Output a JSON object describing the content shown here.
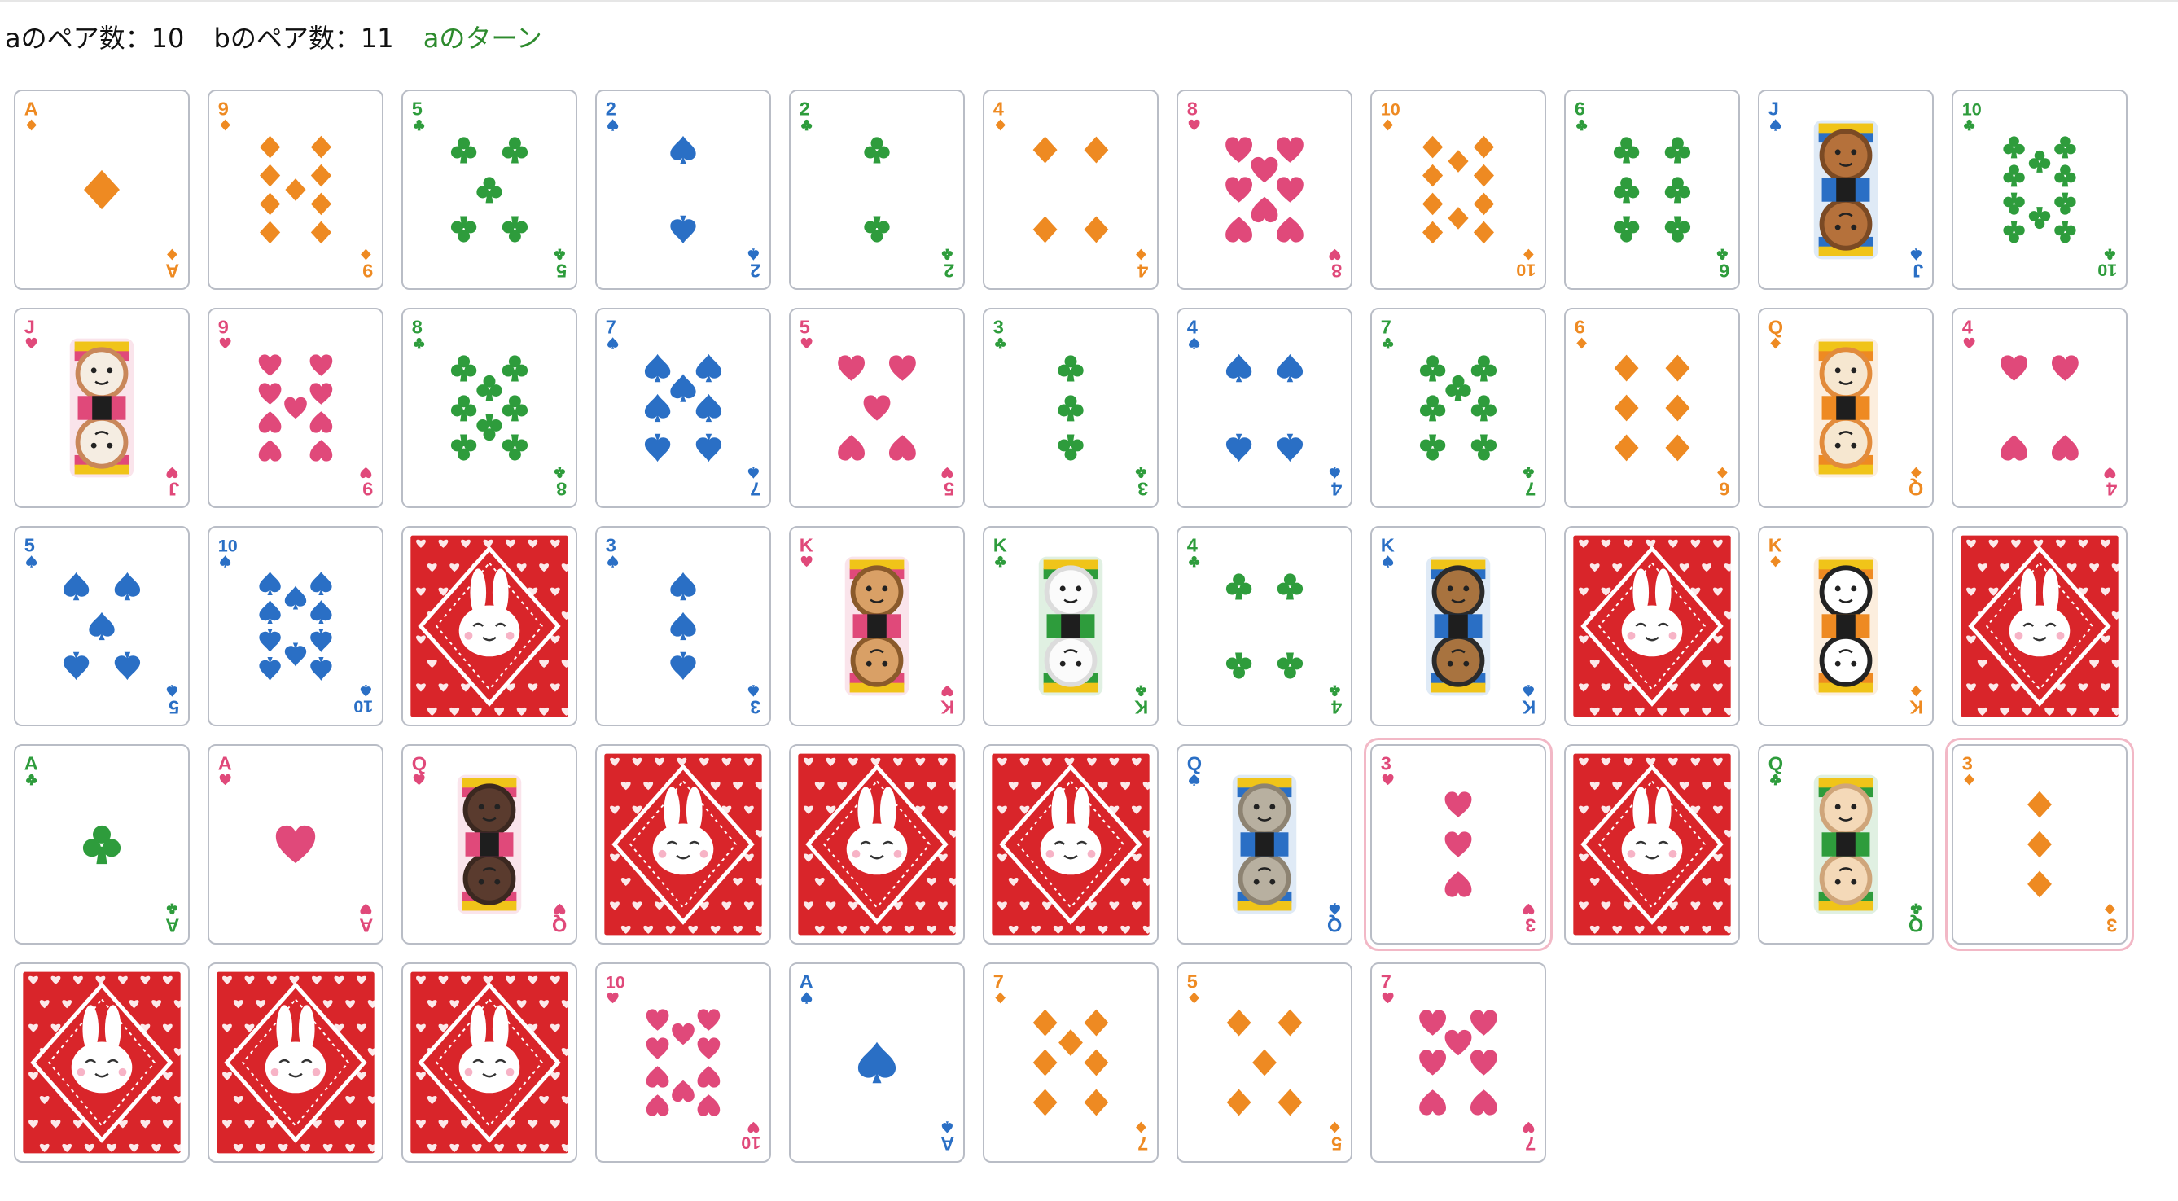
{
  "status": {
    "a_pairs": "aのペア数：10",
    "b_pairs": "bのペア数：11",
    "turn": "aのターン"
  },
  "suit_colors": {
    "D": "#ee8a22",
    "H": "#e0497a",
    "C": "#2e9c3c",
    "S": "#2a6fc5"
  },
  "back_colors": {
    "base": "#d9252a",
    "pattern": "#ffffff"
  },
  "rows": [
    [
      {
        "face": "up",
        "rank": "A",
        "suit": "D"
      },
      {
        "face": "up",
        "rank": "9",
        "suit": "D"
      },
      {
        "face": "up",
        "rank": "5",
        "suit": "C"
      },
      {
        "face": "up",
        "rank": "2",
        "suit": "S"
      },
      {
        "face": "up",
        "rank": "2",
        "suit": "C"
      },
      {
        "face": "up",
        "rank": "4",
        "suit": "D"
      },
      {
        "face": "up",
        "rank": "8",
        "suit": "H"
      },
      {
        "face": "up",
        "rank": "10",
        "suit": "D"
      },
      {
        "face": "up",
        "rank": "6",
        "suit": "C"
      },
      {
        "face": "up",
        "rank": "J",
        "suit": "S",
        "character": "dog-jack"
      },
      {
        "face": "up",
        "rank": "10",
        "suit": "C"
      }
    ],
    [
      {
        "face": "up",
        "rank": "J",
        "suit": "H",
        "character": "bulldog-jack"
      },
      {
        "face": "up",
        "rank": "9",
        "suit": "H"
      },
      {
        "face": "up",
        "rank": "8",
        "suit": "C"
      },
      {
        "face": "up",
        "rank": "7",
        "suit": "S"
      },
      {
        "face": "up",
        "rank": "5",
        "suit": "H"
      },
      {
        "face": "up",
        "rank": "3",
        "suit": "C"
      },
      {
        "face": "up",
        "rank": "4",
        "suit": "S"
      },
      {
        "face": "up",
        "rank": "7",
        "suit": "C"
      },
      {
        "face": "up",
        "rank": "6",
        "suit": "D"
      },
      {
        "face": "up",
        "rank": "Q",
        "suit": "D",
        "character": "calico-cat-queen"
      },
      {
        "face": "up",
        "rank": "4",
        "suit": "H"
      }
    ],
    [
      {
        "face": "up",
        "rank": "5",
        "suit": "S"
      },
      {
        "face": "up",
        "rank": "10",
        "suit": "S"
      },
      {
        "face": "down"
      },
      {
        "face": "up",
        "rank": "3",
        "suit": "S"
      },
      {
        "face": "up",
        "rank": "K",
        "suit": "H",
        "character": "brown-bear-king"
      },
      {
        "face": "up",
        "rank": "K",
        "suit": "C",
        "character": "polar-bear-king"
      },
      {
        "face": "up",
        "rank": "4",
        "suit": "C"
      },
      {
        "face": "up",
        "rank": "K",
        "suit": "S",
        "character": "black-bear-king"
      },
      {
        "face": "down"
      },
      {
        "face": "up",
        "rank": "K",
        "suit": "D",
        "character": "panda-king"
      },
      {
        "face": "down"
      }
    ],
    [
      {
        "face": "up",
        "rank": "A",
        "suit": "C"
      },
      {
        "face": "up",
        "rank": "A",
        "suit": "H"
      },
      {
        "face": "up",
        "rank": "Q",
        "suit": "H",
        "character": "black-cat-queen"
      },
      {
        "face": "down"
      },
      {
        "face": "down"
      },
      {
        "face": "down"
      },
      {
        "face": "up",
        "rank": "Q",
        "suit": "S",
        "character": "tabby-cat-queen"
      },
      {
        "face": "up",
        "rank": "3",
        "suit": "H",
        "selected": true
      },
      {
        "face": "down"
      },
      {
        "face": "up",
        "rank": "Q",
        "suit": "C",
        "character": "cream-cat-queen"
      },
      {
        "face": "up",
        "rank": "3",
        "suit": "D",
        "selected": true
      }
    ],
    [
      {
        "face": "down"
      },
      {
        "face": "down"
      },
      {
        "face": "down"
      },
      {
        "face": "up",
        "rank": "10",
        "suit": "H"
      },
      {
        "face": "up",
        "rank": "A",
        "suit": "S"
      },
      {
        "face": "up",
        "rank": "7",
        "suit": "D"
      },
      {
        "face": "up",
        "rank": "5",
        "suit": "D"
      },
      {
        "face": "up",
        "rank": "7",
        "suit": "H"
      }
    ]
  ]
}
